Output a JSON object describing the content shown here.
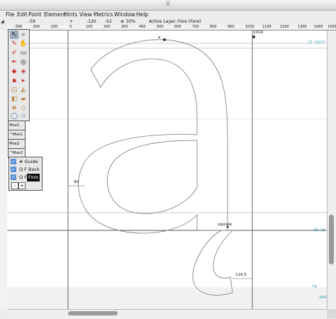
{
  "window": {
    "title": "X"
  },
  "menu": [
    "File",
    "Edit",
    "Point",
    "Element",
    "Hints",
    "View",
    "Metrics",
    "Window",
    "Help"
  ],
  "infobar": {
    "left_value": "-59",
    "coord_a": "-120",
    "coord_b": "-52",
    "zoom": "50%",
    "active_layer": "Active Layer: Fore (Fore)"
  },
  "ruler_ticks": [
    "-300",
    "-200",
    "-100",
    "0",
    "100",
    "200",
    "300",
    "400",
    "500",
    "600",
    "700",
    "800",
    "900",
    "1000",
    "1100",
    "1200",
    "1300",
    "1400",
    "1500"
  ],
  "toolbox": {
    "tools": [
      "pointer-icon",
      "magnify-icon",
      "freehand-icon",
      "scroll-icon",
      "knife-icon",
      "ruler-icon",
      "pen-icon",
      "spiro-icon",
      "curve-point-icon",
      "hv-curve-icon",
      "corner-point-icon",
      "tangent-point-icon",
      "scale-icon",
      "rotate-icon",
      "flip-icon",
      "skew-icon",
      "3d-rotate-icon",
      "perspective-icon",
      "rectangle-icon",
      "polygon-icon"
    ],
    "mouse_states": [
      "Mse1",
      "^Mse1",
      "Mse2",
      "^Mse2"
    ]
  },
  "layers": [
    {
      "check": "✓",
      "label": "# Guide"
    },
    {
      "check": "✓",
      "label": "Q F  Back"
    },
    {
      "check": "✓",
      "label": "Q F",
      "active_label": "Fore"
    }
  ],
  "layer_buttons": [
    "-",
    "+"
  ],
  "canvas_labels": {
    "glyph_name": "a",
    "width_top": "1019",
    "right_top_a": "21",
    "right_top_b": "1023",
    "left_bearing": "90",
    "anchor": "ogonek",
    "right_mid_a": "-29",
    "right_mid_b": "-25",
    "ogonek_dist": "119.5",
    "bottom_a": "74",
    "bottom_b": "-394"
  },
  "colors": {
    "guide": "#8a8a8a",
    "outline": "#777777",
    "teal": "#3aa6b0"
  }
}
